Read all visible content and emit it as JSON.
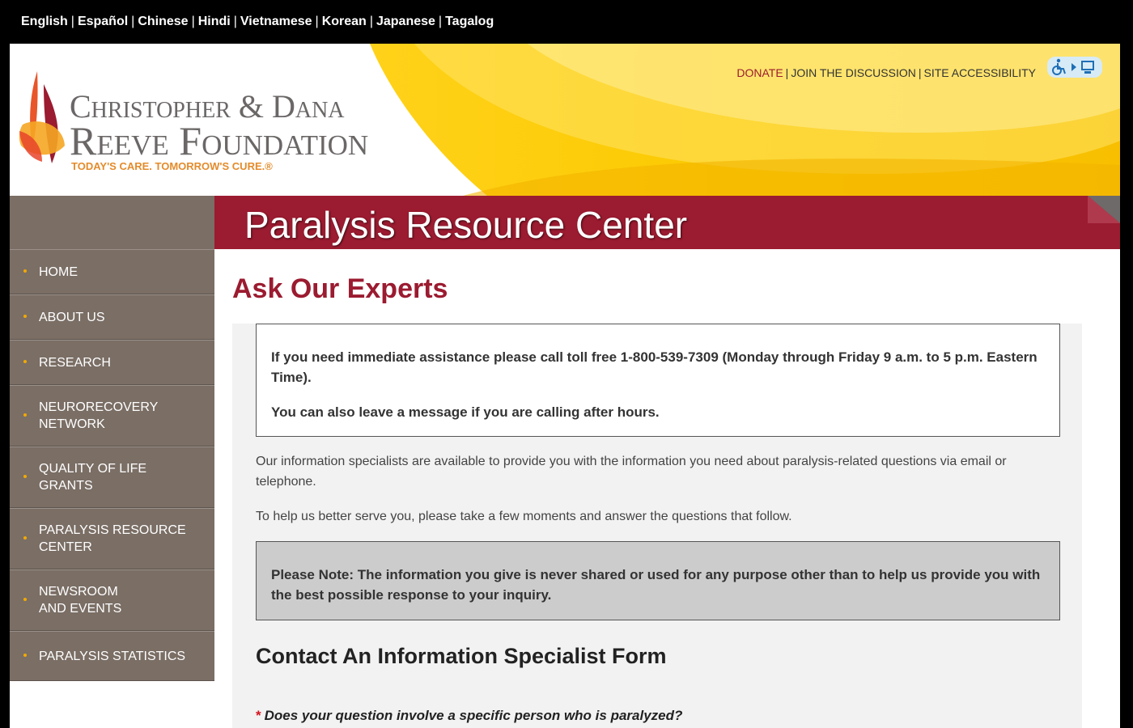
{
  "languages": [
    "English",
    "Español",
    "Chinese",
    "Hindi",
    "Vietnamese",
    "Korean",
    "Japanese",
    "Tagalog"
  ],
  "logo": {
    "line1": "Christopher & Dana",
    "line2": "Reeve Foundation",
    "tagline": "TODAY'S CARE. TOMORROW'S CURE.®"
  },
  "utility_links": {
    "donate": "DONATE",
    "join": "JOIN THE DISCUSSION",
    "accessibility": "SITE ACCESSIBILITY"
  },
  "accessibility_icons": [
    "wheelchair-icon",
    "play-icon",
    "monitor-icon"
  ],
  "banner": {
    "title": "Paralysis Resource Center"
  },
  "nav": [
    {
      "label": "HOME"
    },
    {
      "label": "ABOUT US"
    },
    {
      "label": "RESEARCH"
    },
    {
      "label": "NEURORECOVERY NETWORK",
      "line1": "NEURORECOVERY",
      "line2": "NETWORK"
    },
    {
      "label": "QUALITY OF LIFE GRANTS",
      "line1": "QUALITY OF LIFE",
      "line2": "GRANTS"
    },
    {
      "label": "PARALYSIS RESOURCE CENTER",
      "line1": "PARALYSIS RESOURCE",
      "line2": "CENTER"
    },
    {
      "label": "NEWSROOM AND EVENTS",
      "line1": "NEWSROOM",
      "line2": "AND EVENTS"
    },
    {
      "label": "PARALYSIS STATISTICS"
    }
  ],
  "main": {
    "heading": "Ask Our Experts",
    "assistance": "If you need immediate assistance please call toll free 1-800-539-7309 (Monday through Friday 9 a.m. to 5 p.m. Eastern Time).",
    "after_hours": "You can also leave a message if you are calling after hours.",
    "intro1": "Our information specialists are available to provide you with the information you need about paralysis-related questions via email or telephone.",
    "intro2": "To help us better serve you, please take a few moments and answer the questions that follow.",
    "note": "Please Note: The information you give is never shared or used for any purpose other than to help us provide you with the best possible response to your inquiry.",
    "form_title": "Contact An Information Specialist Form",
    "required_marker": "*",
    "question1": "Does your question involve a specific person who is paralyzed?"
  },
  "colors": {
    "brand_red": "#9b1b30",
    "nav_grey": "#7a6e65",
    "brand_yellow": "#fbc900",
    "tagline_orange": "#e48b2b"
  }
}
